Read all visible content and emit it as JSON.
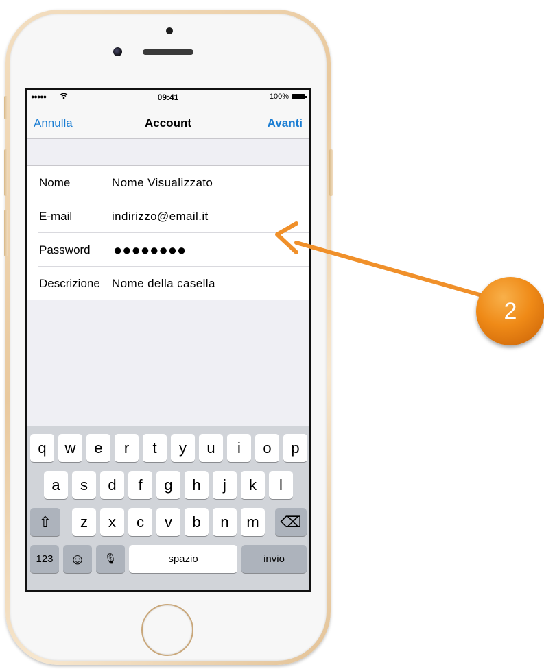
{
  "status_bar": {
    "signal": "●●●●●",
    "time": "09:41",
    "battery": "100%"
  },
  "nav": {
    "cancel_label": "Annulla",
    "title": "Account",
    "next_label": "Avanti"
  },
  "form": {
    "rows": [
      {
        "label": "Nome",
        "value": "Nome Visualizzato"
      },
      {
        "label": "E-mail",
        "value": "indirizzo@email.it"
      },
      {
        "label": "Password",
        "value": "●●●●●●●●"
      },
      {
        "label": "Descrizione",
        "value": "Nome della casella"
      }
    ]
  },
  "keyboard": {
    "row1": [
      "q",
      "w",
      "e",
      "r",
      "t",
      "y",
      "u",
      "i",
      "o",
      "p"
    ],
    "row2": [
      "a",
      "s",
      "d",
      "f",
      "g",
      "h",
      "j",
      "k",
      "l"
    ],
    "row3": [
      "z",
      "x",
      "c",
      "v",
      "b",
      "n",
      "m"
    ],
    "shift_icon": "⇧",
    "delete_icon": "⌫",
    "numbers_label": "123",
    "emoji_icon": "☺",
    "mic_icon": "🎙",
    "space_label": "spazio",
    "return_label": "invio"
  },
  "annotation": {
    "step_number": "2",
    "color": "#f0902a"
  }
}
